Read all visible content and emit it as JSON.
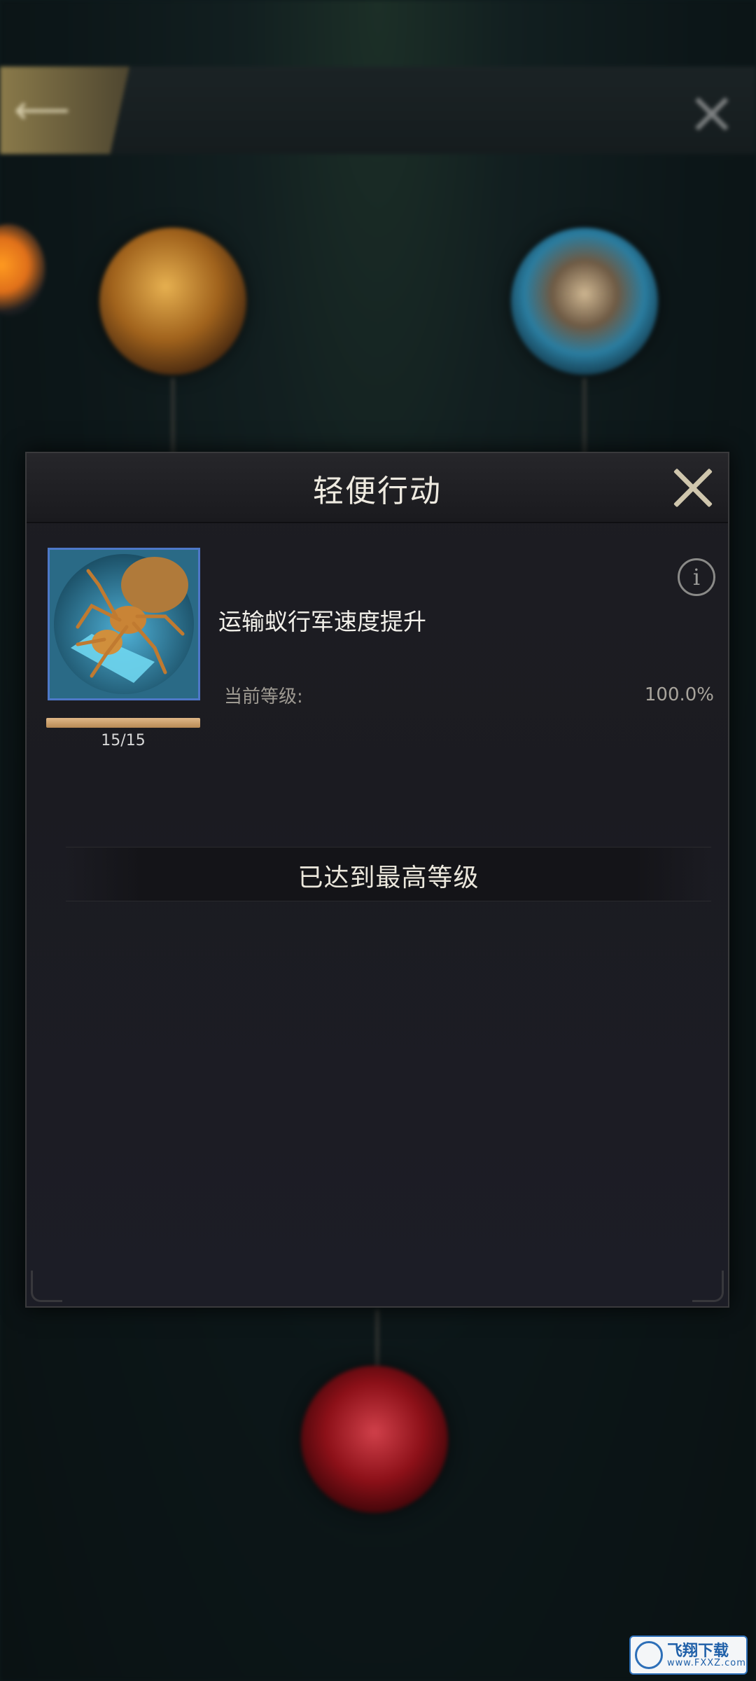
{
  "background": {
    "dots_glyph": "·",
    "colors": {
      "gold_node": "#e6b050",
      "blue_node": "#2a7da0",
      "red_node": "#8c1018"
    }
  },
  "dialog": {
    "title": "轻便行动",
    "skill": {
      "description": "运输蚁行军速度提升",
      "level_text": "15/15",
      "progress_fraction": 1.0,
      "current_level_label": "当前等级:",
      "current_level_value": "100.0%"
    },
    "max_level_text": "已达到最高等级",
    "info_glyph": "i"
  },
  "watermark": {
    "text": "飞翔下载",
    "sub": "www.FXXZ.com"
  },
  "icons": [
    "back-arrow-icon",
    "close-icon",
    "info-icon",
    "ant-skill-icon"
  ]
}
